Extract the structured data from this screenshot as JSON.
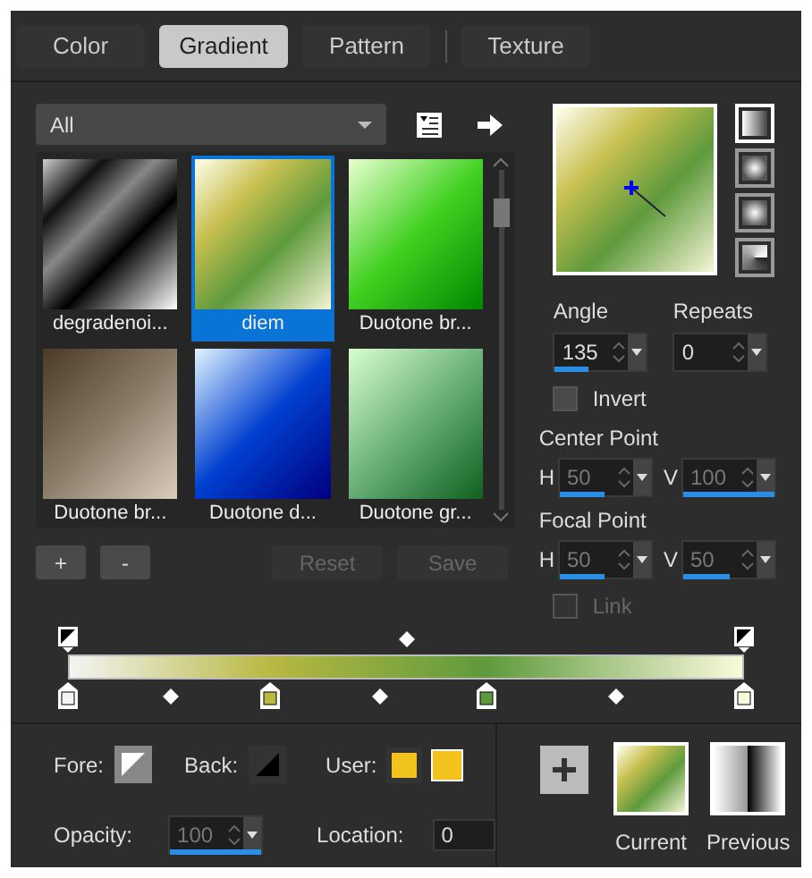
{
  "tabs": [
    {
      "label": "Color",
      "selected": false
    },
    {
      "label": "Gradient",
      "selected": true
    },
    {
      "label": "Pattern",
      "selected": false
    },
    {
      "label": "Texture",
      "selected": false
    }
  ],
  "filter": {
    "value": "All"
  },
  "gradients": [
    {
      "name": "degradenoi...",
      "selected": false
    },
    {
      "name": "diem",
      "selected": true
    },
    {
      "name": "Duotone br...",
      "selected": false
    },
    {
      "name": "Duotone br...",
      "selected": false
    },
    {
      "name": "Duotone d...",
      "selected": false
    },
    {
      "name": "Duotone gr...",
      "selected": false
    }
  ],
  "gradient_types": [
    {
      "kind": "linear",
      "selected": true
    },
    {
      "kind": "rectangular",
      "selected": false
    },
    {
      "kind": "sunburst",
      "selected": false
    },
    {
      "kind": "radial",
      "selected": false
    }
  ],
  "angle": {
    "label": "Angle",
    "value": "135",
    "level": 0.37,
    "disabled": false
  },
  "repeats": {
    "label": "Repeats",
    "value": "0",
    "level": 0,
    "disabled": false
  },
  "invert": {
    "label": "Invert",
    "checked": false,
    "disabled": false
  },
  "center_point": {
    "label": "Center Point",
    "h_label": "H",
    "h": {
      "value": "50",
      "level": 0.5,
      "disabled": true
    },
    "v_label": "V",
    "v": {
      "value": "100",
      "level": 1,
      "disabled": true
    }
  },
  "focal_point": {
    "label": "Focal Point",
    "h_label": "H",
    "h": {
      "value": "50",
      "level": 0.5,
      "disabled": true
    },
    "v_label": "V",
    "v": {
      "value": "50",
      "level": 0.5,
      "disabled": true
    }
  },
  "link": {
    "label": "Link",
    "checked": false,
    "disabled": true
  },
  "buttons": [
    {
      "label": "+",
      "disabled": false
    },
    {
      "label": "-",
      "disabled": false
    },
    {
      "label": "Reset",
      "disabled": true
    },
    {
      "label": "Save",
      "disabled": true
    }
  ],
  "color_stops": [
    {
      "color": "#f4f4f4"
    },
    {
      "color": "#b8b842"
    },
    {
      "color": "#5e9a3c"
    },
    {
      "color": "#fafadc"
    }
  ],
  "fore": {
    "label": "Fore:"
  },
  "back": {
    "label": "Back:"
  },
  "user": {
    "label": "User:",
    "swatches": [
      {
        "color": "#f2c31c"
      },
      {
        "color": "#f2c31c"
      }
    ]
  },
  "opacity": {
    "label": "Opacity:",
    "value": "100",
    "level": 1,
    "disabled": true
  },
  "location": {
    "label": "Location:",
    "value": "0"
  },
  "current": {
    "label": "Current"
  },
  "previous": {
    "label": "Previous"
  }
}
